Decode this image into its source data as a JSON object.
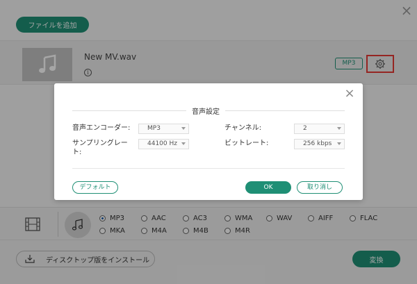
{
  "main": {
    "add_file_label": "ファイルを追加",
    "close_glyph": "×",
    "file": {
      "name": "New MV.wav",
      "format_badge": "MP3",
      "info_glyph": "i"
    }
  },
  "formats": {
    "options": [
      "MP3",
      "AAC",
      "AC3",
      "WMA",
      "WAV",
      "AIFF",
      "FLAC",
      "MKA",
      "M4A",
      "M4B",
      "M4R"
    ],
    "selected": "MP3"
  },
  "footer": {
    "install_label": "ディスクトップ版をインストール",
    "convert_label": "変換"
  },
  "dialog": {
    "title": "音声設定",
    "close_glyph": "×",
    "encoder_label": "音声エンコーダー:",
    "encoder_value": "MP3",
    "channel_label": "チャンネル:",
    "channel_value": "2",
    "samplerate_label": "サンプリングレー ト:",
    "samplerate_value": "44100 Hz",
    "bitrate_label": "ビットレート:",
    "bitrate_value": "256 kbps",
    "default_label": "デフォルト",
    "ok_label": "OK",
    "cancel_label": "取り消し"
  },
  "colors": {
    "accent": "#1f8f75",
    "highlight": "#e53935"
  },
  "icons": [
    "close-icon",
    "music-note-icon",
    "info-icon",
    "gear-icon",
    "film-icon",
    "download-icon"
  ]
}
